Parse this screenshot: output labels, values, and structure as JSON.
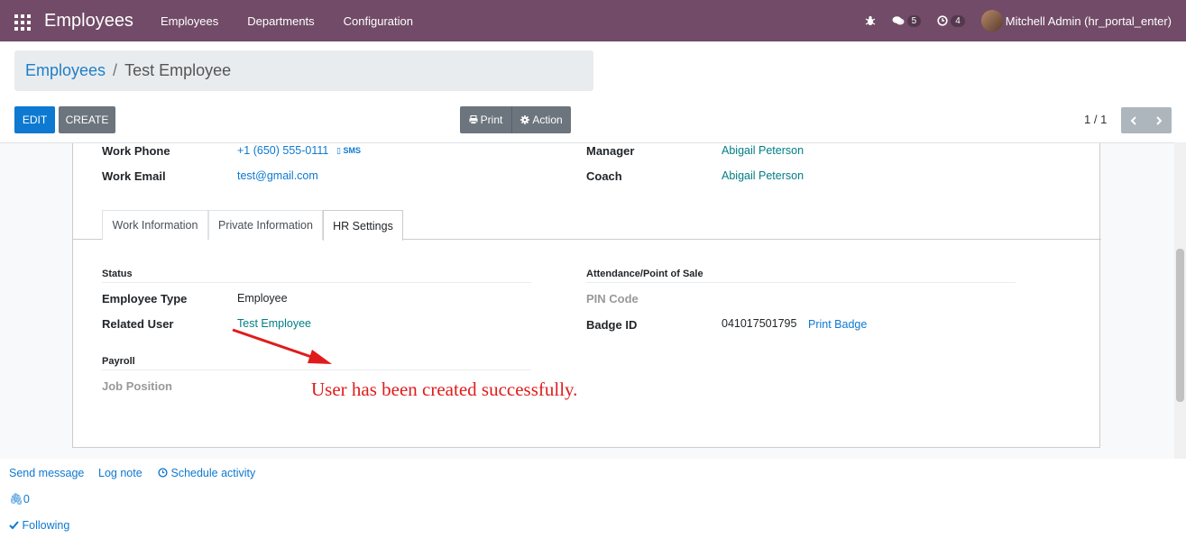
{
  "navbar": {
    "app_title": "Employees",
    "menu": [
      "Employees",
      "Departments",
      "Configuration"
    ],
    "messages_count": "5",
    "activities_count": "4",
    "user_name": "Mitchell Admin (hr_portal_enter)"
  },
  "breadcrumb": {
    "parent": "Employees",
    "separator": "/",
    "current": "Test Employee"
  },
  "buttons": {
    "edit": "EDIT",
    "create": "CREATE",
    "print": "Print",
    "action": "Action"
  },
  "pager": {
    "value": "1 / 1"
  },
  "form": {
    "work_phone_label": "Work Phone",
    "work_phone": "+1 (650) 555-0111",
    "sms": "SMS",
    "work_email_label": "Work Email",
    "work_email": "test@gmail.com",
    "manager_label": "Manager",
    "manager": "Abigail Peterson",
    "coach_label": "Coach",
    "coach": "Abigail Peterson",
    "tabs": [
      "Work Information",
      "Private Information",
      "HR Settings"
    ],
    "active_tab": "HR Settings",
    "status_title": "Status",
    "employee_type_label": "Employee Type",
    "employee_type": "Employee",
    "related_user_label": "Related User",
    "related_user": "Test Employee",
    "payroll_title": "Payroll",
    "job_position_label": "Job Position",
    "attendance_title": "Attendance/Point of Sale",
    "pin_code_label": "PIN Code",
    "badge_id_label": "Badge ID",
    "badge_id": "041017501795",
    "print_badge": "Print Badge"
  },
  "annotation": {
    "text": "User has been created successfully.",
    "color": "#e11b1b"
  },
  "chatter": {
    "send_message": "Send message",
    "log_note": "Log note",
    "schedule_activity": "Schedule activity",
    "attachments": "0",
    "following": "Following"
  },
  "colors": {
    "navbar": "#714B67",
    "primary": "#0d79d1",
    "link": "#017e84"
  }
}
